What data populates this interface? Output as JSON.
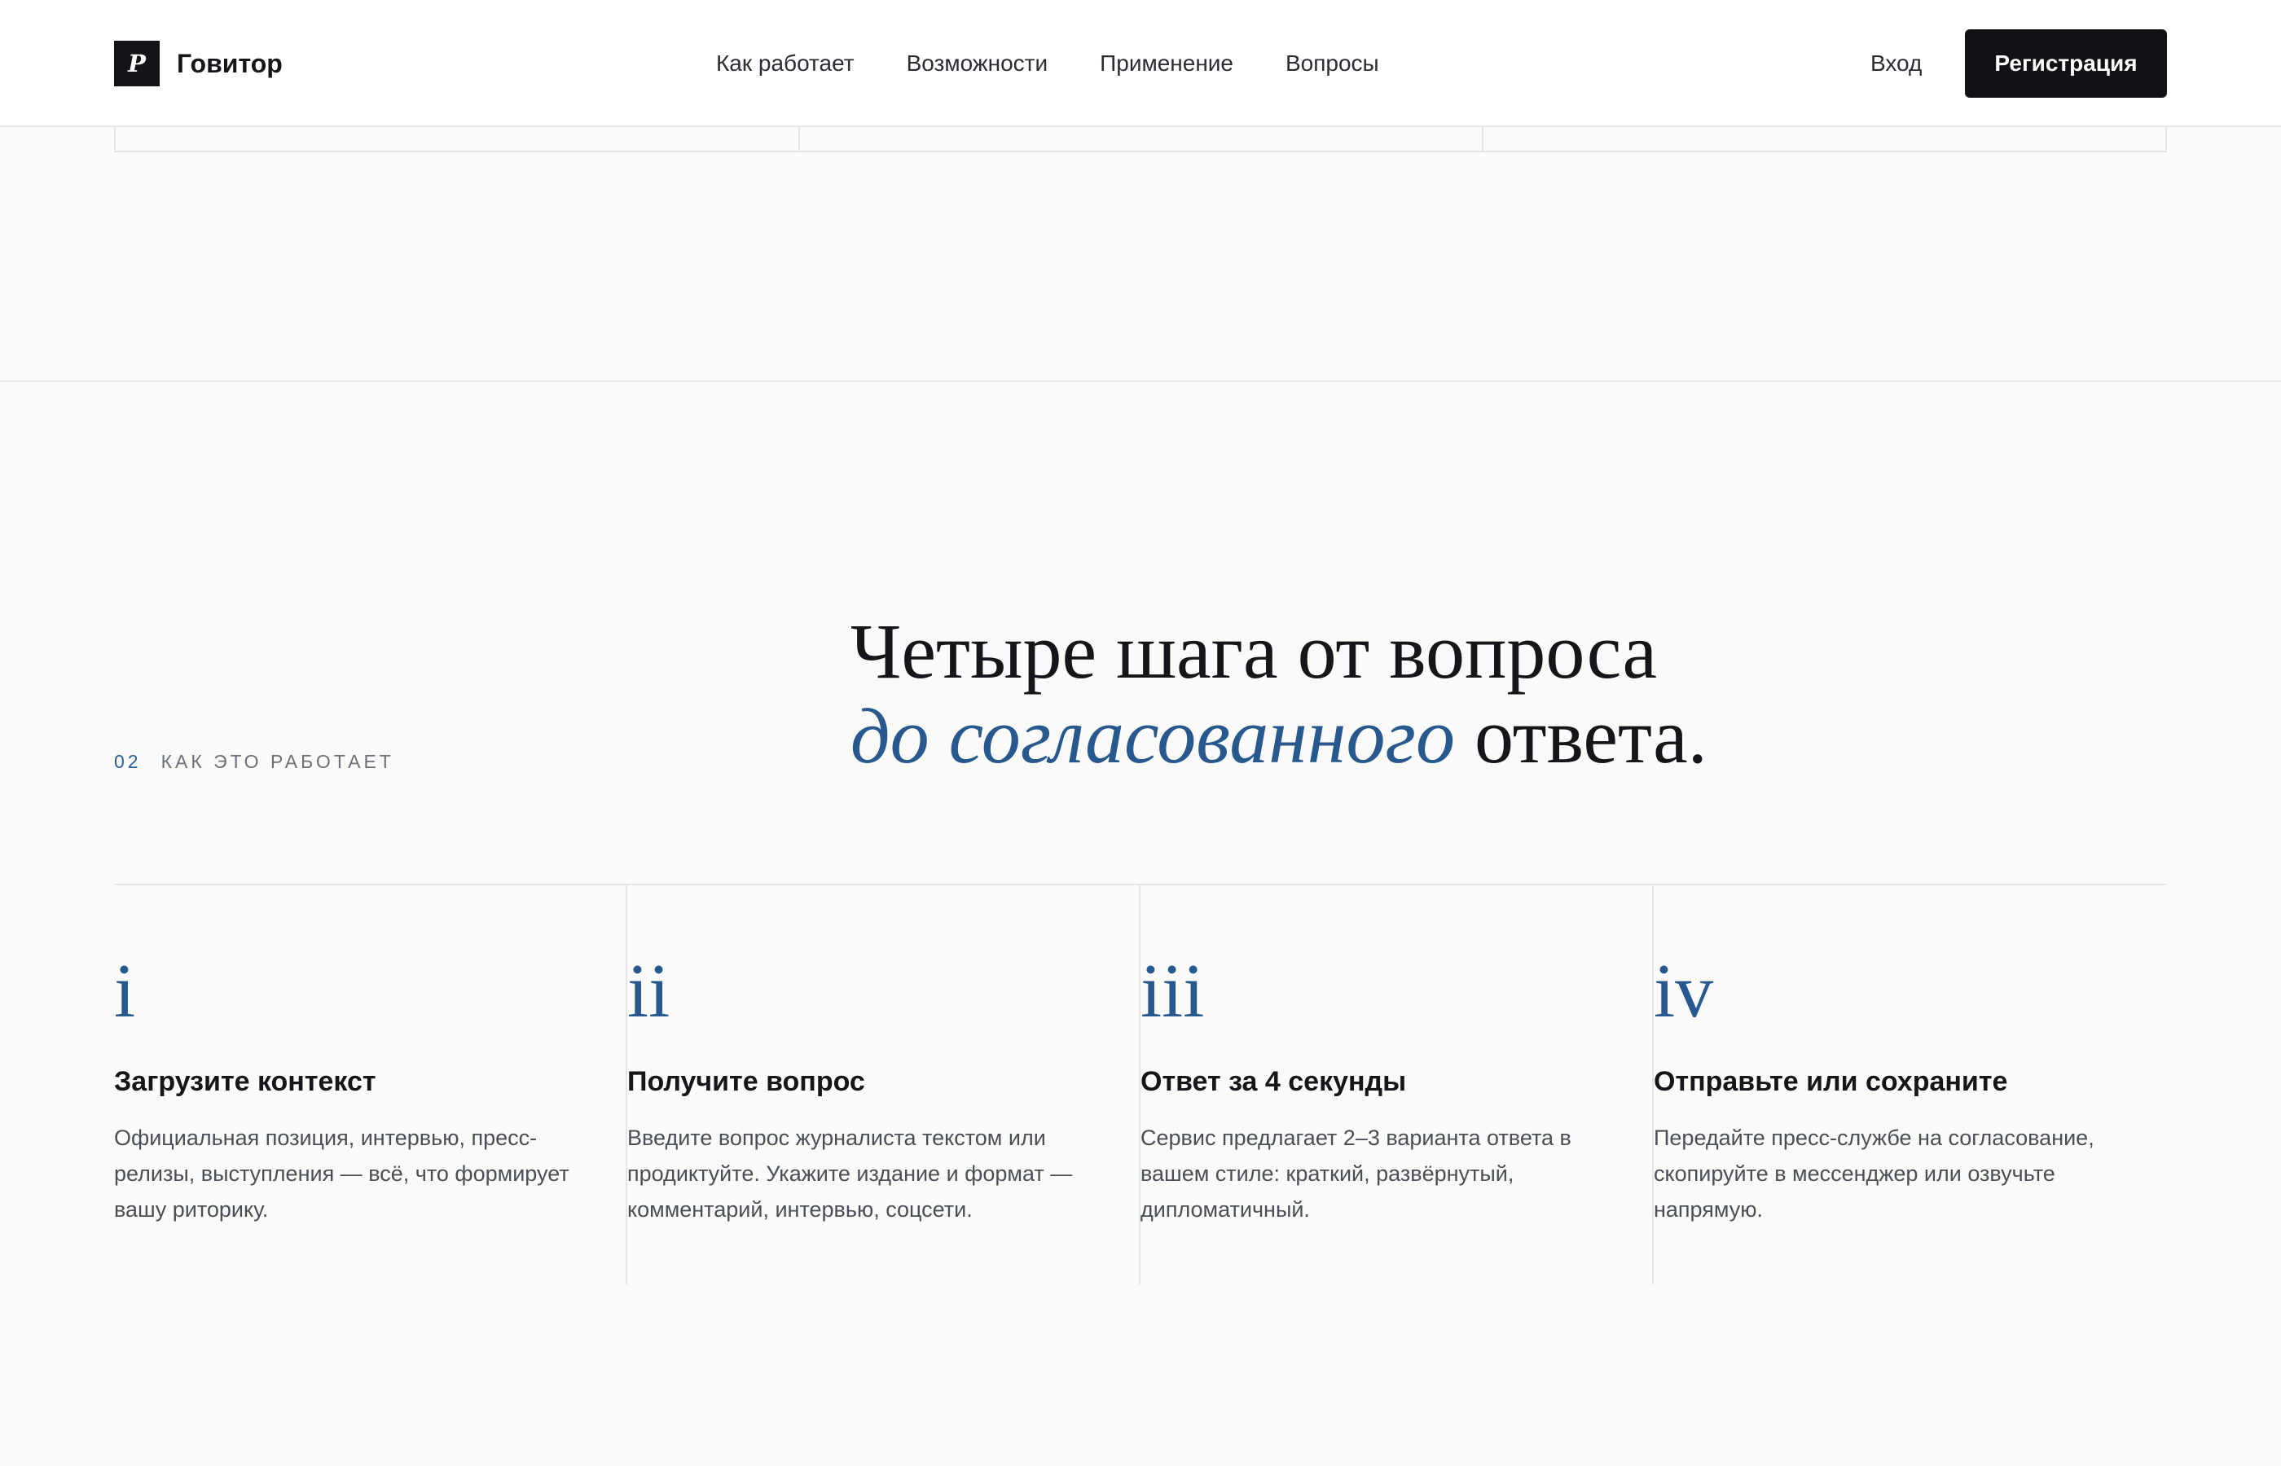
{
  "header": {
    "brand": {
      "logo_letter": "P",
      "name": "Говитор"
    },
    "nav": [
      {
        "label": "Как работает"
      },
      {
        "label": "Возможности"
      },
      {
        "label": "Применение"
      },
      {
        "label": "Вопросы"
      }
    ],
    "login_label": "Вход",
    "register_label": "Регистрация"
  },
  "section": {
    "eyebrow_number": "02",
    "eyebrow_label": "Как это работает",
    "headline_line1": "Четыре шага от вопроса",
    "headline_accent": "до согласованного",
    "headline_end": " ответа."
  },
  "steps": [
    {
      "numeral": "i",
      "title": "Загрузите контекст",
      "text": "Официальная позиция, интервью, пресс-релизы, выступления — всё, что формирует вашу риторику."
    },
    {
      "numeral": "ii",
      "title": "Получите вопрос",
      "text": "Введите вопрос журналиста текстом или продиктуйте. Укажите издание и формат — комментарий, интервью, соцсети."
    },
    {
      "numeral": "iii",
      "title": "Ответ за 4 секунды",
      "text": "Сервис предлагает 2–3 варианта ответа в вашем стиле: краткий, развёрнутый, дипломатичный."
    },
    {
      "numeral": "iv",
      "title": "Отправьте или сохраните",
      "text": "Передайте пресс-службе на согласование, скопируйте в мессенджер или озвучьте напрямую."
    }
  ],
  "colors": {
    "accent": "#27598e",
    "dark": "#0f1115",
    "background": "#fafaf9"
  }
}
